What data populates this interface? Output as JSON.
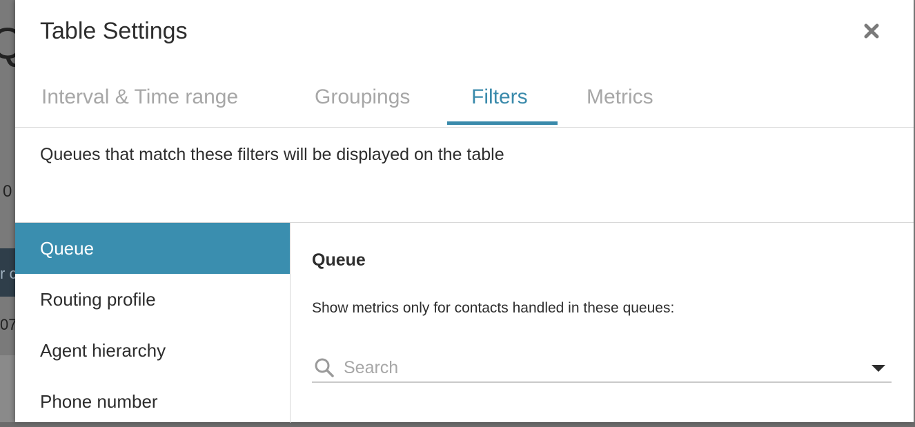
{
  "background": {
    "partial_title_char": "Q",
    "partial_value": "0",
    "partial_bar_text": "r c",
    "partial_number": "07"
  },
  "modal": {
    "title": "Table Settings",
    "close_icon": "close-icon"
  },
  "tabs": [
    {
      "label": "Interval & Time range",
      "active": false
    },
    {
      "label": "Groupings",
      "active": false
    },
    {
      "label": "Filters",
      "active": true
    },
    {
      "label": "Metrics",
      "active": false
    }
  ],
  "description": "Queues that match these filters will be displayed on the table",
  "filters": {
    "items": [
      {
        "label": "Queue",
        "selected": true
      },
      {
        "label": "Routing profile",
        "selected": false
      },
      {
        "label": "Agent hierarchy",
        "selected": false
      },
      {
        "label": "Phone number",
        "selected": false
      }
    ]
  },
  "detail": {
    "title": "Queue",
    "description": "Show metrics only for contacts handled in these queues:",
    "search": {
      "placeholder": "Search",
      "value": "",
      "icon": "search-icon",
      "dropdown_icon": "chevron-down-icon"
    }
  },
  "colors": {
    "accent": "#3a8aab",
    "selected_bg": "#3a8eaf",
    "inactive_tab": "#a7a7a7",
    "text": "#2d2d2d"
  }
}
